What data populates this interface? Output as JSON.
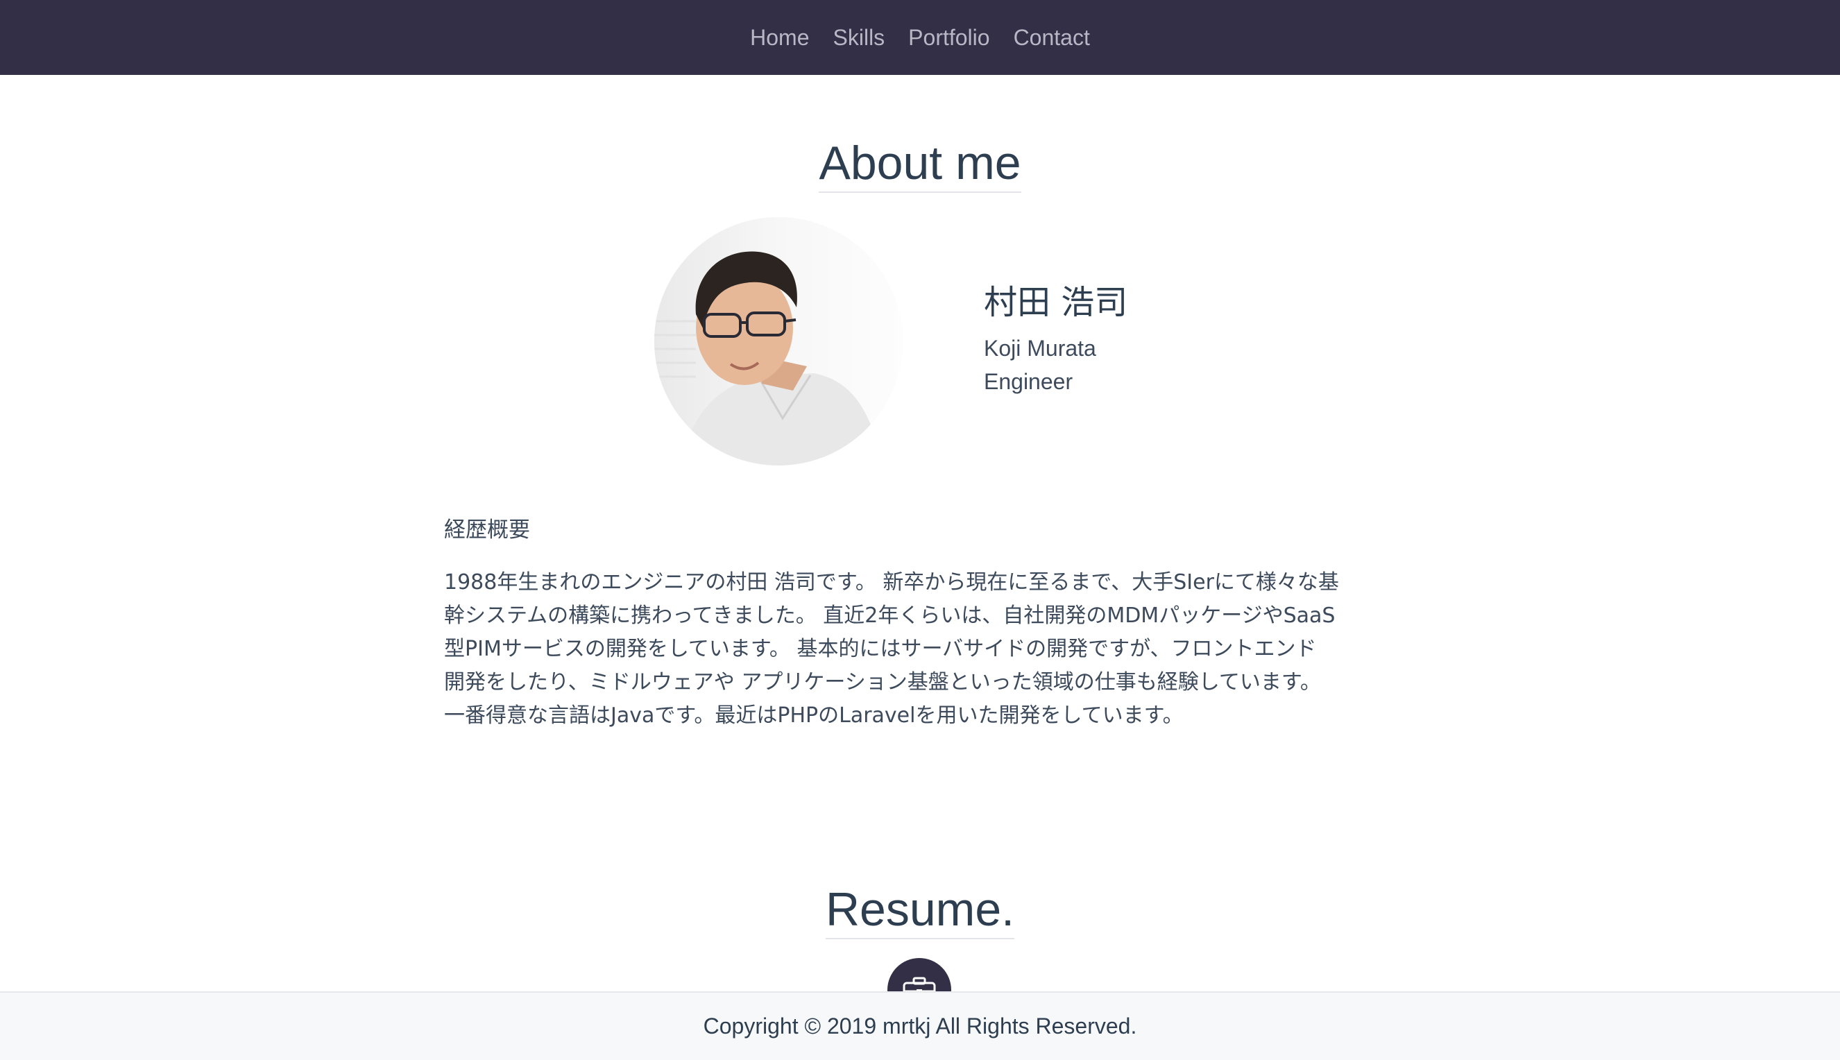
{
  "nav": {
    "items": [
      {
        "label": "Home"
      },
      {
        "label": "Skills"
      },
      {
        "label": "Portfolio"
      },
      {
        "label": "Contact"
      }
    ]
  },
  "about": {
    "title": "About me",
    "name_ja": "村田 浩司",
    "name_en": "Koji Murata",
    "role": "Engineer",
    "career_heading": "経歴概要",
    "career_lines": [
      "1988年生まれのエンジニアの村田 浩司です。 新卒から現在に至るまで、大手SIerにて様々な基",
      "幹システムの構築に携わってきました。 直近2年くらいは、自社開発のMDMパッケージやSaaS",
      "型PIMサービスの開発をしています。 基本的にはサーバサイドの開発ですが、フロントエンド",
      "開発をしたり、ミドルウェアや アプリケーション基盤といった領域の仕事も経験しています。",
      "一番得意な言語はJavaです。最近はPHPのLaravelを用いた開発をしています。"
    ]
  },
  "resume": {
    "title": "Resume.",
    "icon": "briefcase-icon"
  },
  "footer": {
    "copyright": "Copyright © 2019 mrtkj All Rights Reserved."
  },
  "colors": {
    "navbar_bg": "#332f47",
    "nav_text": "#b9b7c6",
    "heading": "#2d3e50",
    "body_text": "#3c4a5c",
    "footer_bg": "#f7f8fa"
  }
}
